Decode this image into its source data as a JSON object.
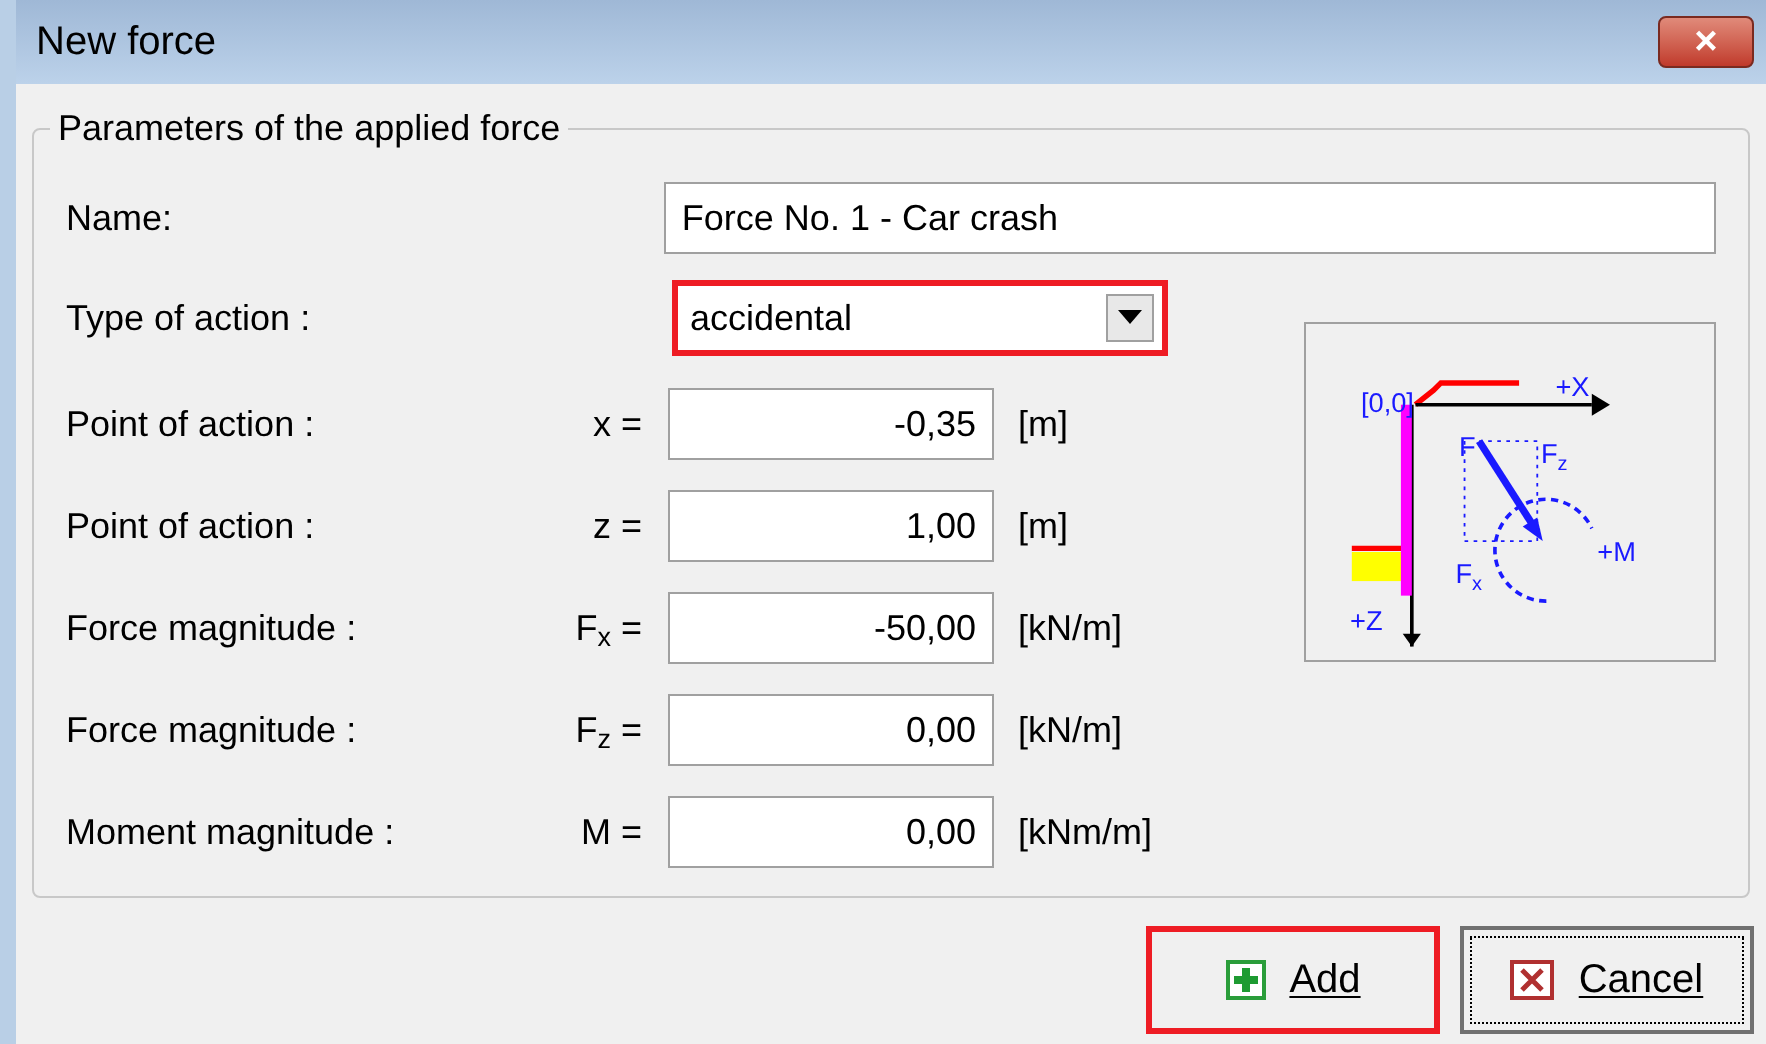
{
  "window": {
    "title": "New force",
    "close": "×"
  },
  "group": {
    "title": "Parameters of the applied force"
  },
  "name_field": {
    "label": "Name:",
    "value": "Force No. 1 - Car crash"
  },
  "type_field": {
    "label": "Type of action :",
    "value": "accidental",
    "highlighted": true
  },
  "rows": [
    {
      "label": "Point of action :",
      "symbol": "x =",
      "value": "-0,35",
      "unit": "[m]"
    },
    {
      "label": "Point of action :",
      "symbol": "z =",
      "value": "1,00",
      "unit": "[m]"
    },
    {
      "label": "Force magnitude :",
      "symbol": "F$_{x}$ =",
      "value": "-50,00",
      "unit": "[kN/m]"
    },
    {
      "label": "Force magnitude :",
      "symbol": "F$_{z}$ =",
      "value": "0,00",
      "unit": "[kN/m]"
    },
    {
      "label": "Moment magnitude :",
      "symbol": "M =",
      "value": "0,00",
      "unit": "[kNm/m]"
    }
  ],
  "diagram": {
    "origin": "[0,0]",
    "x_axis": "+X",
    "z_axis": "+Z",
    "force": "F",
    "fz": "F$_{z}$",
    "fx": "F$_{x}$",
    "moment": "+M"
  },
  "buttons": [
    {
      "kind": "add",
      "label": "Add",
      "highlighted": true
    },
    {
      "kind": "cancel",
      "label": "Cancel",
      "highlighted": false
    }
  ]
}
